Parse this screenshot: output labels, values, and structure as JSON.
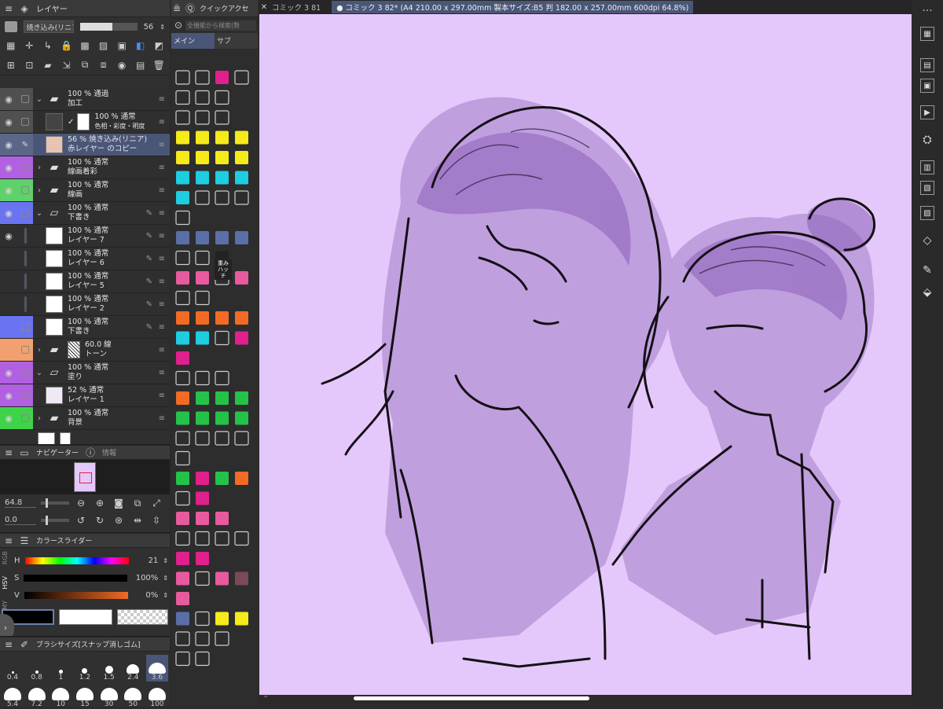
{
  "layer_panel": {
    "tab_title": "レイヤー",
    "blend_mode": "焼き込み(リニア)",
    "opacity": "56",
    "layers": [
      {
        "line1": "100 % 通過",
        "line2": "加工",
        "type": "folder",
        "color": ""
      },
      {
        "line1": "100 % 通常",
        "line2": "色相・彩度・明度",
        "type": "correction",
        "color": ""
      },
      {
        "line1": "56 % 焼き込み(リニア)",
        "line2": "赤レイヤー のコピー",
        "type": "raster",
        "color": "",
        "selected": true
      },
      {
        "line1": "100 % 通常",
        "line2": "線画着彩",
        "type": "folder",
        "color": "#b060e0"
      },
      {
        "line1": "100 % 通常",
        "line2": "線画",
        "type": "folder",
        "color": "#5fd16a"
      },
      {
        "line1": "100 % 通常",
        "line2": "下書き",
        "type": "folder",
        "color": "#6a74f0"
      },
      {
        "line1": "100 % 通常",
        "line2": "レイヤー 7",
        "type": "raster",
        "color": ""
      },
      {
        "line1": "100 % 通常",
        "line2": "レイヤー 6",
        "type": "raster",
        "color": ""
      },
      {
        "line1": "100 % 通常",
        "line2": "レイヤー 5",
        "type": "raster",
        "color": ""
      },
      {
        "line1": "100 % 通常",
        "line2": "レイヤー 2",
        "type": "raster",
        "color": ""
      },
      {
        "line1": "100 % 通常",
        "line2": "下書き",
        "type": "raster",
        "color": "#6a74f0"
      },
      {
        "line1": "60.0 線",
        "line2": "トーン",
        "type": "folder",
        "color": "#f2a070"
      },
      {
        "line1": "100 % 通常",
        "line2": "塗り",
        "type": "folder",
        "color": "#b060e0"
      },
      {
        "line1": "52 % 通常",
        "line2": "レイヤー 1",
        "type": "raster",
        "color": "#b060e0"
      },
      {
        "line1": "100 % 通常",
        "line2": "背景",
        "type": "folder",
        "color": "#3fd34a"
      }
    ]
  },
  "navigator": {
    "tab_title": "ナビゲーター",
    "info_tab": "情報",
    "zoom": "64.8",
    "rotation": "0.0"
  },
  "color_slider": {
    "tab_title": "カラースライダー",
    "mode_rgb": "RGB",
    "mode_hsv": "HSV",
    "mode_cmy": "CMY",
    "h_label": "H",
    "h_value": "21",
    "s_label": "S",
    "s_value": "100%",
    "v_label": "V",
    "v_value": "0%"
  },
  "brush_size": {
    "tab_title": "ブラシサイズ[スナップ消しゴム]",
    "sizes": [
      "0.4",
      "0.8",
      "1",
      "1.2",
      "1.5",
      "2.4",
      "3.6",
      "5.4",
      "7.2",
      "10",
      "15",
      "30",
      "50",
      "100"
    ]
  },
  "quick_access": {
    "tab_title": "クイックアクセ",
    "search_placeholder": "全機能から検索(数",
    "tab_main": "メイン",
    "tab_sub": "サブ",
    "hatch_label": "重みハッチ"
  },
  "document_tabs": [
    {
      "label": "コミック 3 81"
    },
    {
      "label": "コミック 3 82* (A4 210.00 x 297.00mm 製本サイズ:B5 判 182.00 x 257.00mm 600dpi 64.8%)"
    }
  ],
  "colors": {
    "canvas_bg": "#e5c8fb",
    "selected_layer": "#4a5677",
    "accent_yellow": "#f5ea1a",
    "accent_cyan": "#1ecde0",
    "accent_magenta": "#e0208c",
    "accent_pink": "#e85a9e",
    "accent_orange": "#f26b25",
    "accent_green": "#25c24a"
  }
}
